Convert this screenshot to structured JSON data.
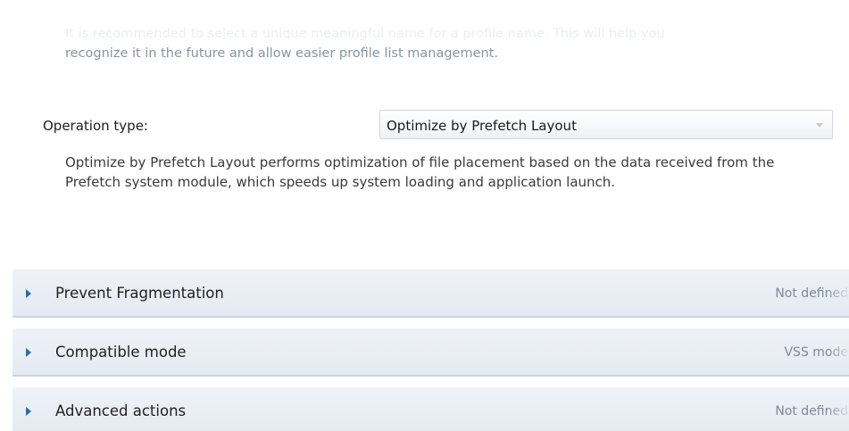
{
  "hint": {
    "line1": "It is recommended to select a unique meaningful name for a profile name. This will help you",
    "line2": "recognize it in the future and allow easier profile list management."
  },
  "operation": {
    "label": "Operation type:",
    "selected": "Optimize by Prefetch Layout",
    "description": "Optimize by Prefetch Layout performs optimization of file placement based on the data received from the Prefetch system module, which speeds up system loading and application launch."
  },
  "sections": [
    {
      "title": "Prevent Fragmentation",
      "status": "Not defined"
    },
    {
      "title": "Compatible mode",
      "status": "VSS mode"
    },
    {
      "title": "Advanced actions",
      "status": "Not defined"
    }
  ]
}
